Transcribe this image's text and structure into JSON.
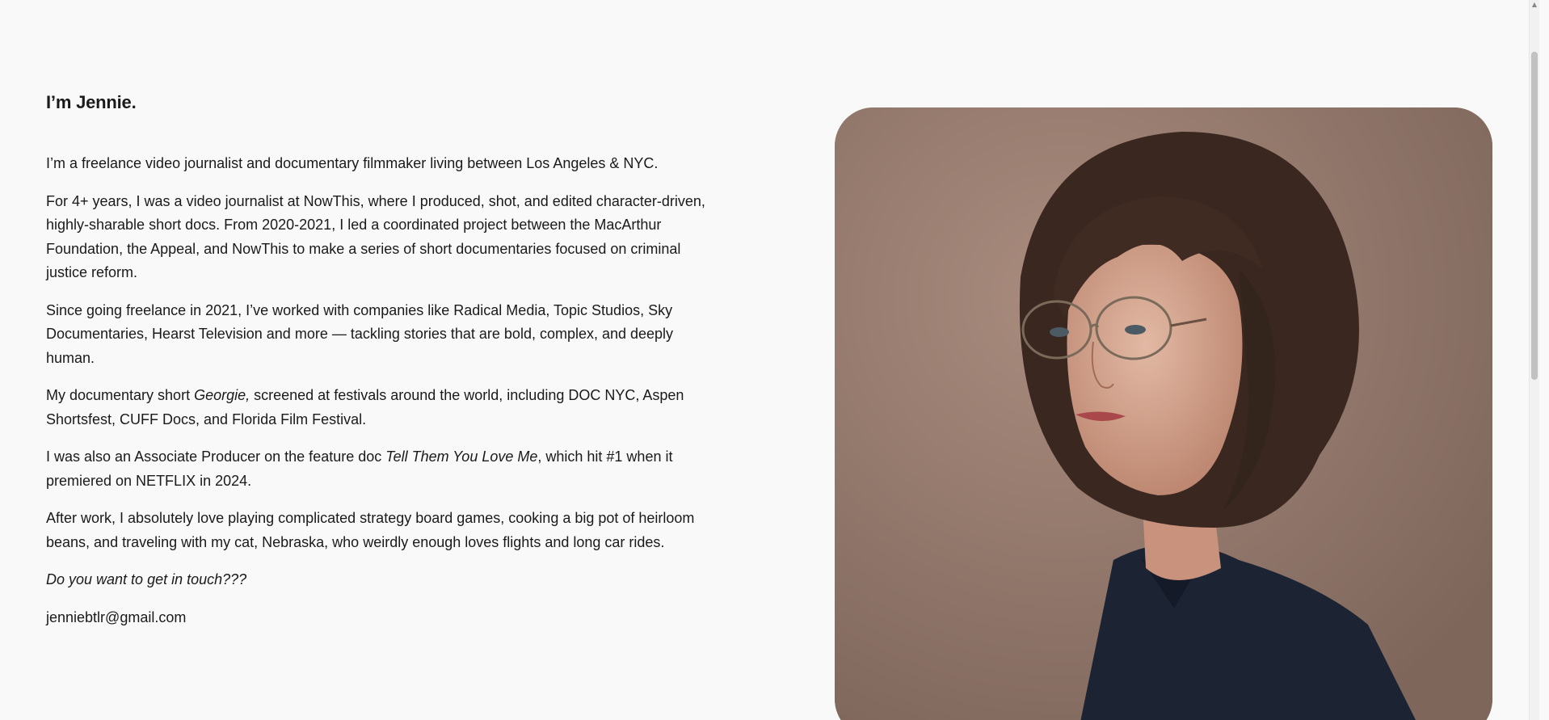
{
  "about": {
    "heading": "I’m Jennie.",
    "paragraphs": {
      "p1": "I’m a freelance video journalist and documentary filmmaker living between Los Angeles & NYC.",
      "p2": "For 4+ years, I was a video journalist at NowThis, where I produced, shot, and edited character-driven, highly-sharable short docs. From 2020-2021, I led a coordinated project between the MacArthur Foundation, the Appeal, and NowThis to make a series of short documentaries focused on criminal justice reform.",
      "p3": "Since going freelance in 2021, I’ve worked with companies like Radical Media, Topic Studios, Sky Documentaries, Hearst Television and more — tackling stories that are bold, complex, and deeply human.",
      "p4_before": "My documentary short ",
      "p4_title": "Georgie,",
      "p4_after": " screened at festivals around the world, including DOC NYC, Aspen Shortsfest, CUFF Docs, and Florida Film Festival.",
      "p5_before": "I was also an Associate Producer on the feature doc ",
      "p5_title": "Tell Them You Love Me",
      "p5_after": ", which hit #1 when it premiered on NETFLIX in 2024.",
      "p6": "After work, I absolutely love playing complicated strategy board games, cooking a big pot of heirloom beans, and traveling with my cat, Nebraska, who weirdly enough loves flights and long car rides.",
      "cta": "Do you want to get in touch???",
      "email": "jenniebtlr@gmail.com"
    }
  },
  "colors": {
    "background": "#f9f9f9",
    "text": "#1a1a1a",
    "photo_backdrop": "#9a7d70"
  },
  "icons": {
    "scroll_up": "▲"
  }
}
